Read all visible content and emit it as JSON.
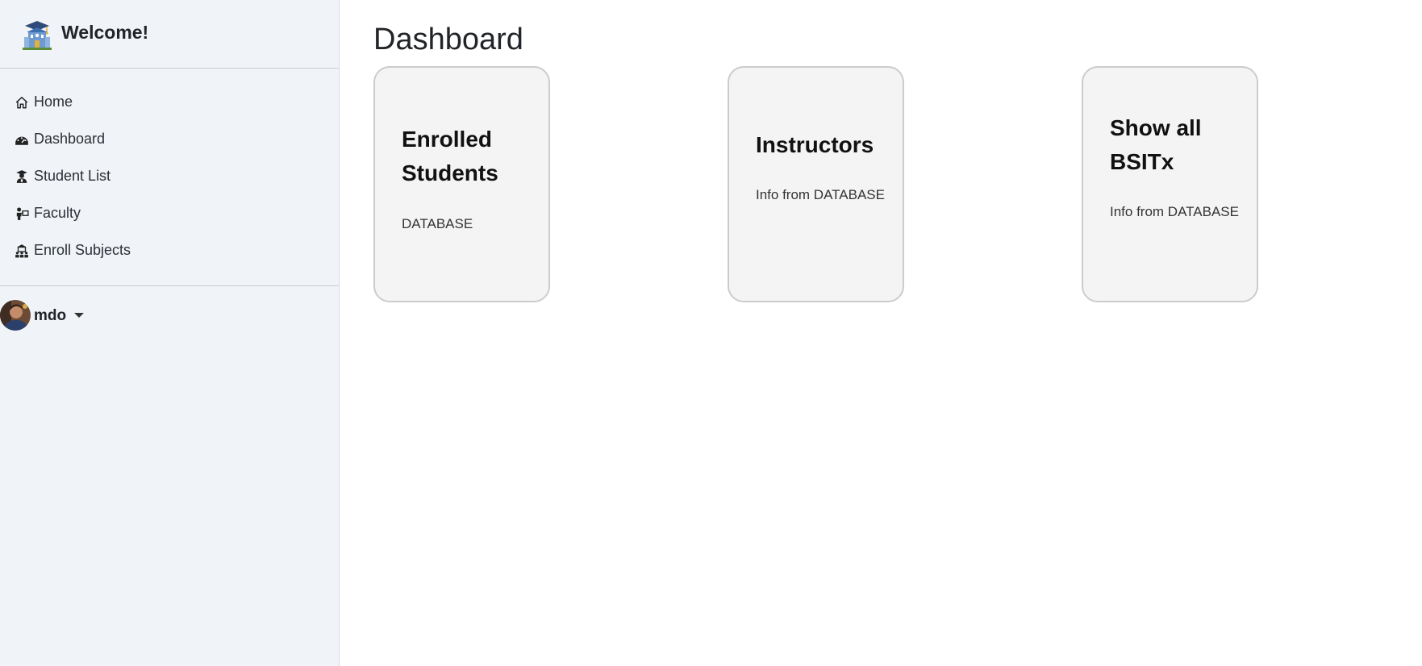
{
  "brand": {
    "title": "Welcome!",
    "logo_icon": "school-building-icon"
  },
  "nav": {
    "items": [
      {
        "label": "Home",
        "icon": "house-icon"
      },
      {
        "label": "Dashboard",
        "icon": "speedometer-icon"
      },
      {
        "label": "Student List",
        "icon": "graduate-person-icon"
      },
      {
        "label": "Faculty",
        "icon": "teacher-icon"
      },
      {
        "label": "Enroll Subjects",
        "icon": "building-people-icon"
      }
    ]
  },
  "user": {
    "name": "mdo",
    "avatar_icon": "user-avatar"
  },
  "main": {
    "title": "Dashboard",
    "cards": [
      {
        "title": "Enrolled Students",
        "text": "DATABASE"
      },
      {
        "title": "Instructors",
        "text": "Info from DATABASE"
      },
      {
        "title": "Show all BSITx",
        "text": "Info from DATABASE"
      }
    ]
  },
  "colors": {
    "sidebar_bg": "#f0f3f7",
    "card_bg": "#f4f4f4",
    "card_border": "#cccccc",
    "text": "#212529"
  }
}
